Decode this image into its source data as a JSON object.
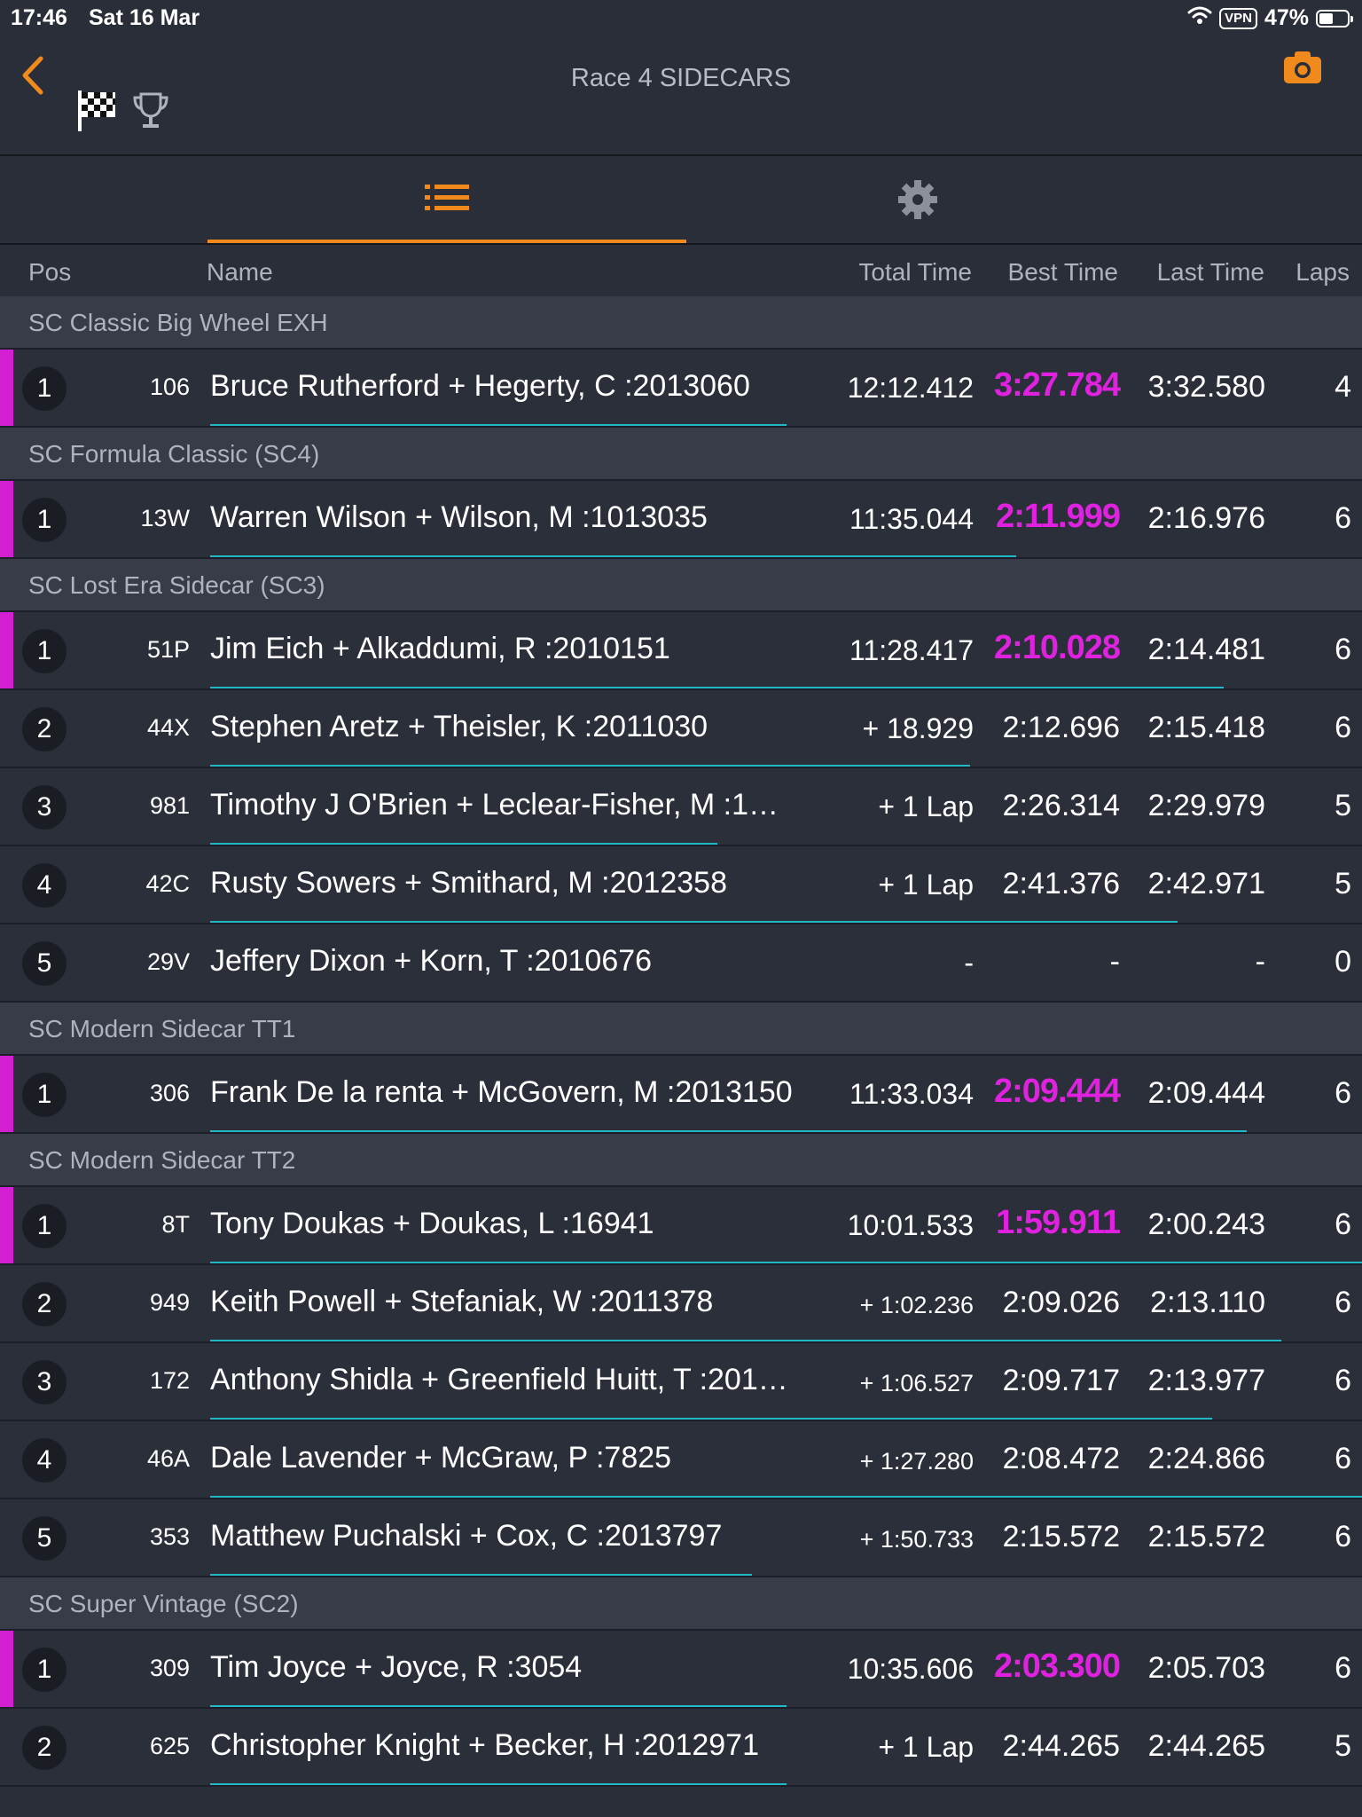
{
  "status_bar": {
    "time": "17:46",
    "date": "Sat 16 Mar",
    "vpn": "VPN",
    "battery": "47%"
  },
  "header": {
    "title": "Race 4 SIDECARS"
  },
  "icons": {
    "back": "chevron-left-icon",
    "camera": "camera-icon",
    "flag": "checkered-flag-icon",
    "trophy": "trophy-icon",
    "list": "list-icon",
    "settings": "gear-icon"
  },
  "colors": {
    "accent": "#f08a1c",
    "leader": "#d11fd1",
    "best_time": "#e021e0",
    "progress": "#21b9c8",
    "background": "#2a2e39"
  },
  "columns": {
    "pos": "Pos",
    "name": "Name",
    "total": "Total Time",
    "best": "Best Time",
    "last": "Last Time",
    "laps": "Laps"
  },
  "groups": [
    {
      "title": "SC Classic Big Wheel EXH",
      "rows": [
        {
          "pos": "1",
          "num": "106",
          "name": "Bruce Rutherford + Hegerty, C :2013060",
          "total": "12:12.412",
          "best": "3:27.784",
          "last": "3:32.580",
          "laps": "4",
          "leader": true,
          "progress": 0.5
        }
      ]
    },
    {
      "title": "SC Formula Classic (SC4)",
      "rows": [
        {
          "pos": "1",
          "num": "13W",
          "name": "Warren Wilson + Wilson, M :1013035",
          "total": "11:35.044",
          "best": "2:11.999",
          "last": "2:16.976",
          "laps": "6",
          "leader": true,
          "progress": 0.7
        }
      ]
    },
    {
      "title": "SC Lost Era Sidecar (SC3)",
      "rows": [
        {
          "pos": "1",
          "num": "51P",
          "name": "Jim Eich + Alkaddumi, R :2010151",
          "total": "11:28.417",
          "best": "2:10.028",
          "last": "2:14.481",
          "laps": "6",
          "leader": true,
          "progress": 0.88
        },
        {
          "pos": "2",
          "num": "44X",
          "name": "Stephen Aretz + Theisler, K :2011030",
          "total": "+ 18.929",
          "best": "2:12.696",
          "last": "2:15.418",
          "laps": "6",
          "leader": false,
          "progress": 0.66
        },
        {
          "pos": "3",
          "num": "981",
          "name": "Timothy J O'Brien + Leclear-Fisher, M :1…",
          "total": "+ 1 Lap",
          "best": "2:26.314",
          "last": "2:29.979",
          "laps": "5",
          "leader": false,
          "progress": 0.44
        },
        {
          "pos": "4",
          "num": "42C",
          "name": "Rusty Sowers + Smithard, M :2012358",
          "total": "+ 1 Lap",
          "best": "2:41.376",
          "last": "2:42.971",
          "laps": "5",
          "leader": false,
          "progress": 0.84
        },
        {
          "pos": "5",
          "num": "29V",
          "name": "Jeffery Dixon + Korn, T :2010676",
          "total": "-",
          "best": "-",
          "last": "-",
          "laps": "0",
          "leader": false,
          "progress": 0
        }
      ]
    },
    {
      "title": "SC Modern Sidecar TT1",
      "rows": [
        {
          "pos": "1",
          "num": "306",
          "name": "Frank De la renta + McGovern, M :2013150",
          "total": "11:33.034",
          "best": "2:09.444",
          "last": "2:09.444",
          "laps": "6",
          "leader": true,
          "progress": 0.9
        }
      ]
    },
    {
      "title": "SC Modern Sidecar TT2",
      "rows": [
        {
          "pos": "1",
          "num": "8T",
          "name": "Tony Doukas + Doukas, L :16941",
          "total": "10:01.533",
          "best": "1:59.911",
          "last": "2:00.243",
          "laps": "6",
          "leader": true,
          "progress": 1.0
        },
        {
          "pos": "2",
          "num": "949",
          "name": "Keith Powell + Stefaniak, W :2011378",
          "total": "+ 1:02.236",
          "best": "2:09.026",
          "last": "2:13.110",
          "laps": "6",
          "leader": false,
          "progress": 0.93
        },
        {
          "pos": "3",
          "num": "172",
          "name": "Anthony Shidla + Greenfield Huitt, T :201…",
          "total": "+ 1:06.527",
          "best": "2:09.717",
          "last": "2:13.977",
          "laps": "6",
          "leader": false,
          "progress": 0.87
        },
        {
          "pos": "4",
          "num": "46A",
          "name": "Dale Lavender + McGraw, P :7825",
          "total": "+ 1:27.280",
          "best": "2:08.472",
          "last": "2:24.866",
          "laps": "6",
          "leader": false,
          "progress": 1.0
        },
        {
          "pos": "5",
          "num": "353",
          "name": "Matthew Puchalski + Cox, C :2013797",
          "total": "+ 1:50.733",
          "best": "2:15.572",
          "last": "2:15.572",
          "laps": "6",
          "leader": false,
          "progress": 0.47
        }
      ]
    },
    {
      "title": "SC Super Vintage (SC2)",
      "rows": [
        {
          "pos": "1",
          "num": "309",
          "name": "Tim Joyce + Joyce, R :3054",
          "total": "10:35.606",
          "best": "2:03.300",
          "last": "2:05.703",
          "laps": "6",
          "leader": true,
          "progress": 0.5
        },
        {
          "pos": "2",
          "num": "625",
          "name": "Christopher Knight + Becker, H :2012971",
          "total": "+ 1 Lap",
          "best": "2:44.265",
          "last": "2:44.265",
          "laps": "5",
          "leader": false,
          "progress": 0.5
        }
      ]
    }
  ]
}
